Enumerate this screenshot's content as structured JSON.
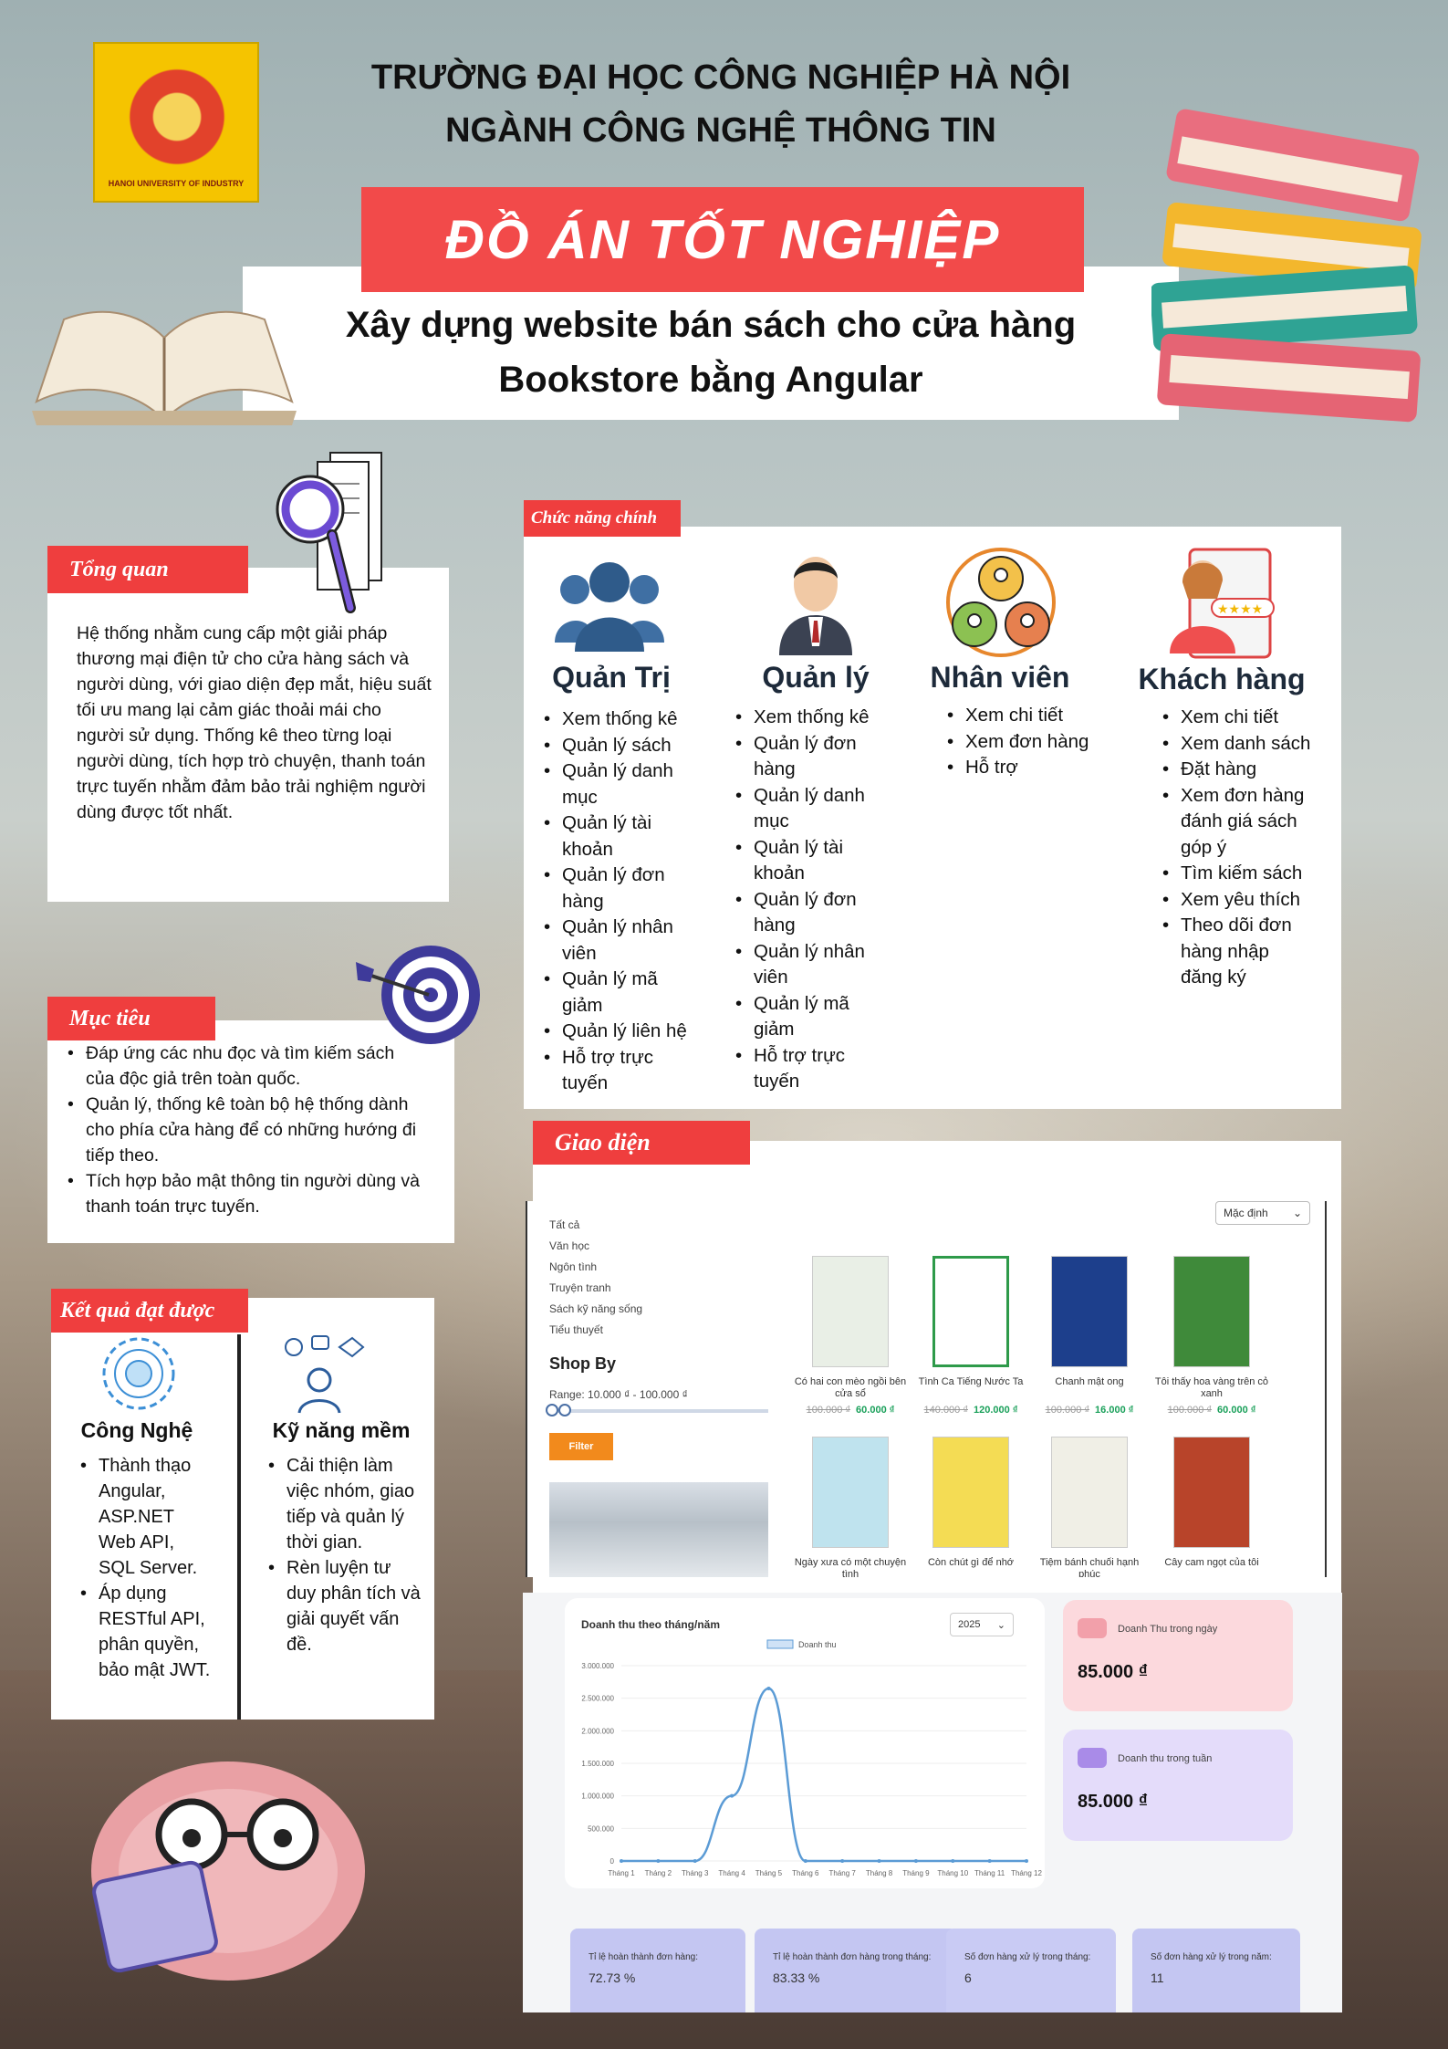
{
  "header": {
    "logo_caption": "HANOI UNIVERSITY OF INDUSTRY",
    "line1": "TRƯỜNG ĐẠI HỌC CÔNG NGHIỆP HÀ NỘI",
    "line2": "NGÀNH CÔNG NGHỆ THÔNG TIN",
    "banner": "ĐỒ ÁN TỐT NGHIỆP",
    "subtitle1": "Xây dựng website bán sách cho cửa hàng",
    "subtitle2": "Bookstore bằng Angular"
  },
  "overview": {
    "tag": "Tổng quan",
    "text": "Hệ thống nhằm cung cấp một giải pháp thương mại điện tử cho cửa hàng sách và người dùng, với giao diện đẹp mắt, hiệu suất tối ưu mang lại cảm giác thoải mái cho người sử dụng. Thống kê theo từng loại người dùng, tích hợp trò chuyện, thanh toán trực tuyến nhằm đảm bảo trải nghiệm người dùng được tốt nhất."
  },
  "goals": {
    "tag": "Mục tiêu",
    "items": [
      "Đáp ứng các nhu đọc và tìm kiếm sách của độc giả trên toàn quốc.",
      "Quản lý, thống kê toàn bộ hệ thống dành cho phía cửa hàng để có những hướng đi tiếp theo.",
      "Tích hợp bảo mật thông tin người dùng và thanh toán trực tuyến."
    ]
  },
  "results": {
    "tag": "Kết quả đạt được",
    "tech": {
      "title": "Công Nghệ",
      "items": [
        "Thành thạo Angular, ASP.NET Web API, SQL Server.",
        "Áp dụng RESTful API, phân quyền, bảo mật JWT."
      ]
    },
    "soft": {
      "title": "Kỹ năng mềm",
      "items": [
        "Cải thiện làm việc nhóm, giao tiếp và quản lý thời gian.",
        "Rèn luyện tư duy phân tích và giải quyết vấn đề."
      ]
    }
  },
  "features": {
    "tag": "Chức năng chính",
    "columns": [
      {
        "title": "Quản Trị",
        "items": [
          "Xem thống kê",
          "Quản lý sách",
          "Quản lý danh mục",
          "Quản lý tài khoản",
          "Quản lý đơn hàng",
          "Quản lý nhân viên",
          "Quản lý mã giảm",
          "Quản lý liên hệ",
          "Hỗ trợ trực tuyến"
        ]
      },
      {
        "title": "Quản lý",
        "items": [
          "Xem thống kê",
          "Quản lý đơn hàng",
          "Quản lý danh mục",
          "Quản lý tài khoản",
          "Quản lý đơn hàng",
          "Quản lý nhân viên",
          "Quản lý mã giảm",
          "Hỗ trợ trực tuyến"
        ]
      },
      {
        "title": "Nhân viên",
        "items": [
          "Xem chi tiết",
          "Xem đơn hàng",
          "Hỗ trợ"
        ]
      },
      {
        "title": "Khách hàng",
        "items": [
          "Xem chi tiết",
          "Xem danh sách",
          "Đặt hàng",
          "Xem đơn hàng đánh giá sách góp ý",
          "Tìm kiếm sách",
          "Xem yêu thích",
          "Theo dõi đơn hàng nhập đăng ký"
        ]
      }
    ]
  },
  "ui": {
    "tag": "Giao diện",
    "store": {
      "categories": [
        "Tất cả",
        "Văn học",
        "Ngôn tình",
        "Truyện tranh",
        "Sách kỹ năng sống",
        "Tiểu thuyết"
      ],
      "shop_by": "Shop By",
      "range": "Range: 10.000 ₫ - 100.000 ₫",
      "filter": "Filter",
      "sort": "Mặc định",
      "books": [
        {
          "title": "Có hai con mèo ngồi bên cửa sổ",
          "old": "100.000 ₫",
          "new": "60.000 ₫",
          "color": "#e9efe6"
        },
        {
          "title": "Tình Ca Tiếng Nước Ta",
          "old": "140.000 ₫",
          "new": "120.000 ₫",
          "color": "#ffffff"
        },
        {
          "title": "Chanh mật ong",
          "old": "100.000 ₫",
          "new": "16.000 ₫",
          "color": "#1d3f8c"
        },
        {
          "title": "Tôi thấy hoa vàng trên cỏ xanh",
          "old": "100.000 ₫",
          "new": "60.000 ₫",
          "color": "#3f8a3a"
        },
        {
          "title": "Ngày xưa có một chuyện tình",
          "old": "",
          "new": "",
          "color": "#bfe3ee"
        },
        {
          "title": "Còn chút gì để nhớ",
          "old": "",
          "new": "",
          "color": "#f4dc54"
        },
        {
          "title": "Tiệm bánh chuối hạnh phúc",
          "old": "",
          "new": "",
          "color": "#f0efe6"
        },
        {
          "title": "Cây cam ngọt của tôi",
          "old": "",
          "new": "",
          "color": "#b8442a"
        }
      ]
    },
    "dashboard": {
      "chart_title": "Doanh thu theo tháng/năm",
      "year": "2025",
      "kpis": [
        {
          "label": "Doanh Thu trong ngày",
          "value": "85.000 ₫"
        },
        {
          "label": "Doanh thu trong tuần",
          "value": "85.000 ₫"
        }
      ],
      "stats": [
        {
          "label": "Tỉ lệ hoàn thành đơn hàng:",
          "value": "72.73 %"
        },
        {
          "label": "Tỉ lệ hoàn thành đơn hàng trong tháng:",
          "value": "83.33 %"
        },
        {
          "label": "Số đơn hàng xử lý trong tháng:",
          "value": "6"
        },
        {
          "label": "Số đơn hàng xử lý trong năm:",
          "value": "11"
        }
      ]
    }
  },
  "chart_data": {
    "type": "line",
    "title": "Doanh thu theo tháng/năm",
    "categories": [
      "Tháng 1",
      "Tháng 2",
      "Tháng 3",
      "Tháng 4",
      "Tháng 5",
      "Tháng 6",
      "Tháng 7",
      "Tháng 8",
      "Tháng 9",
      "Tháng 10",
      "Tháng 11",
      "Tháng 12"
    ],
    "series": [
      {
        "name": "Doanh thu",
        "values": [
          0,
          0,
          0,
          1000000,
          2650000,
          0,
          0,
          0,
          0,
          0,
          0,
          0
        ]
      }
    ],
    "ylim": [
      0,
      3000000
    ],
    "yticks": [
      "0",
      "500.000",
      "1.000.000",
      "1.500.000",
      "2.000.000",
      "2.500.000",
      "3.000.000"
    ],
    "legend": "top",
    "grid": true,
    "color": "#5b9bd5"
  }
}
